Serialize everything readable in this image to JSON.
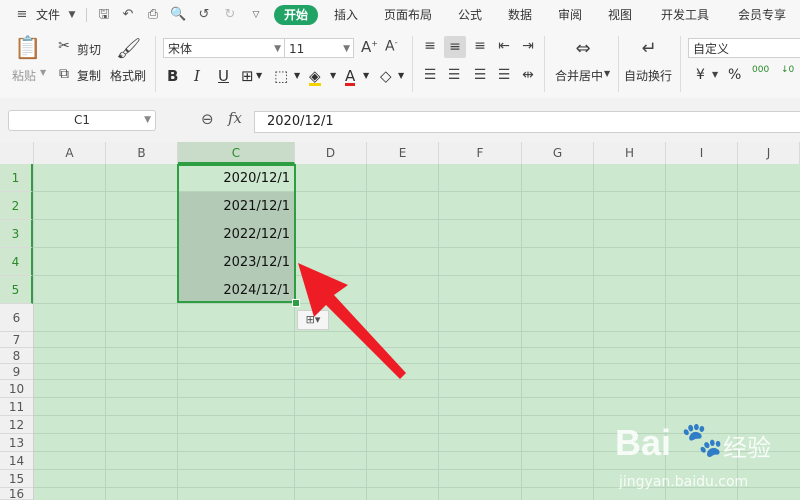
{
  "menu": {
    "file_label": "文件",
    "tabs": [
      "开始",
      "插入",
      "页面布局",
      "公式",
      "数据",
      "审阅",
      "视图",
      "开发工具",
      "会员专享"
    ]
  },
  "ribbon": {
    "paste_label": "粘贴",
    "cut_label": "剪切",
    "copy_label": "复制",
    "format_painter_label": "格式刷",
    "font_name": "宋体",
    "font_size": "11",
    "merge_center_label": "合并居中",
    "wrap_text_label": "自动换行",
    "number_format": "自定义",
    "currency_symbol": "¥",
    "percent_symbol": "%",
    "decimal_label": "000"
  },
  "formula_bar": {
    "name_box": "C1",
    "fx_label": "fx",
    "formula": "2020/12/1"
  },
  "sheet": {
    "columns": [
      "A",
      "B",
      "C",
      "D",
      "E",
      "F",
      "G",
      "H",
      "I",
      "J"
    ],
    "rows": [
      "1",
      "2",
      "3",
      "4",
      "5",
      "6",
      "7",
      "8",
      "9",
      "10",
      "11",
      "12",
      "13",
      "14",
      "15",
      "16"
    ],
    "column_c_values": [
      "2020/12/1",
      "2021/12/1",
      "2022/12/1",
      "2023/12/1",
      "2024/12/1"
    ],
    "selected_column": "C",
    "selected_rows": [
      "1",
      "2",
      "3",
      "4",
      "5"
    ]
  },
  "watermark": {
    "brand": "Bai",
    "brand_suffix": "经验",
    "url": "jingyan.baidu.com"
  },
  "colors": {
    "accent_green": "#21a366",
    "selection_border": "#2e9e43",
    "sheet_background": "#cce8cf",
    "arrow_red": "#ee1c25"
  }
}
